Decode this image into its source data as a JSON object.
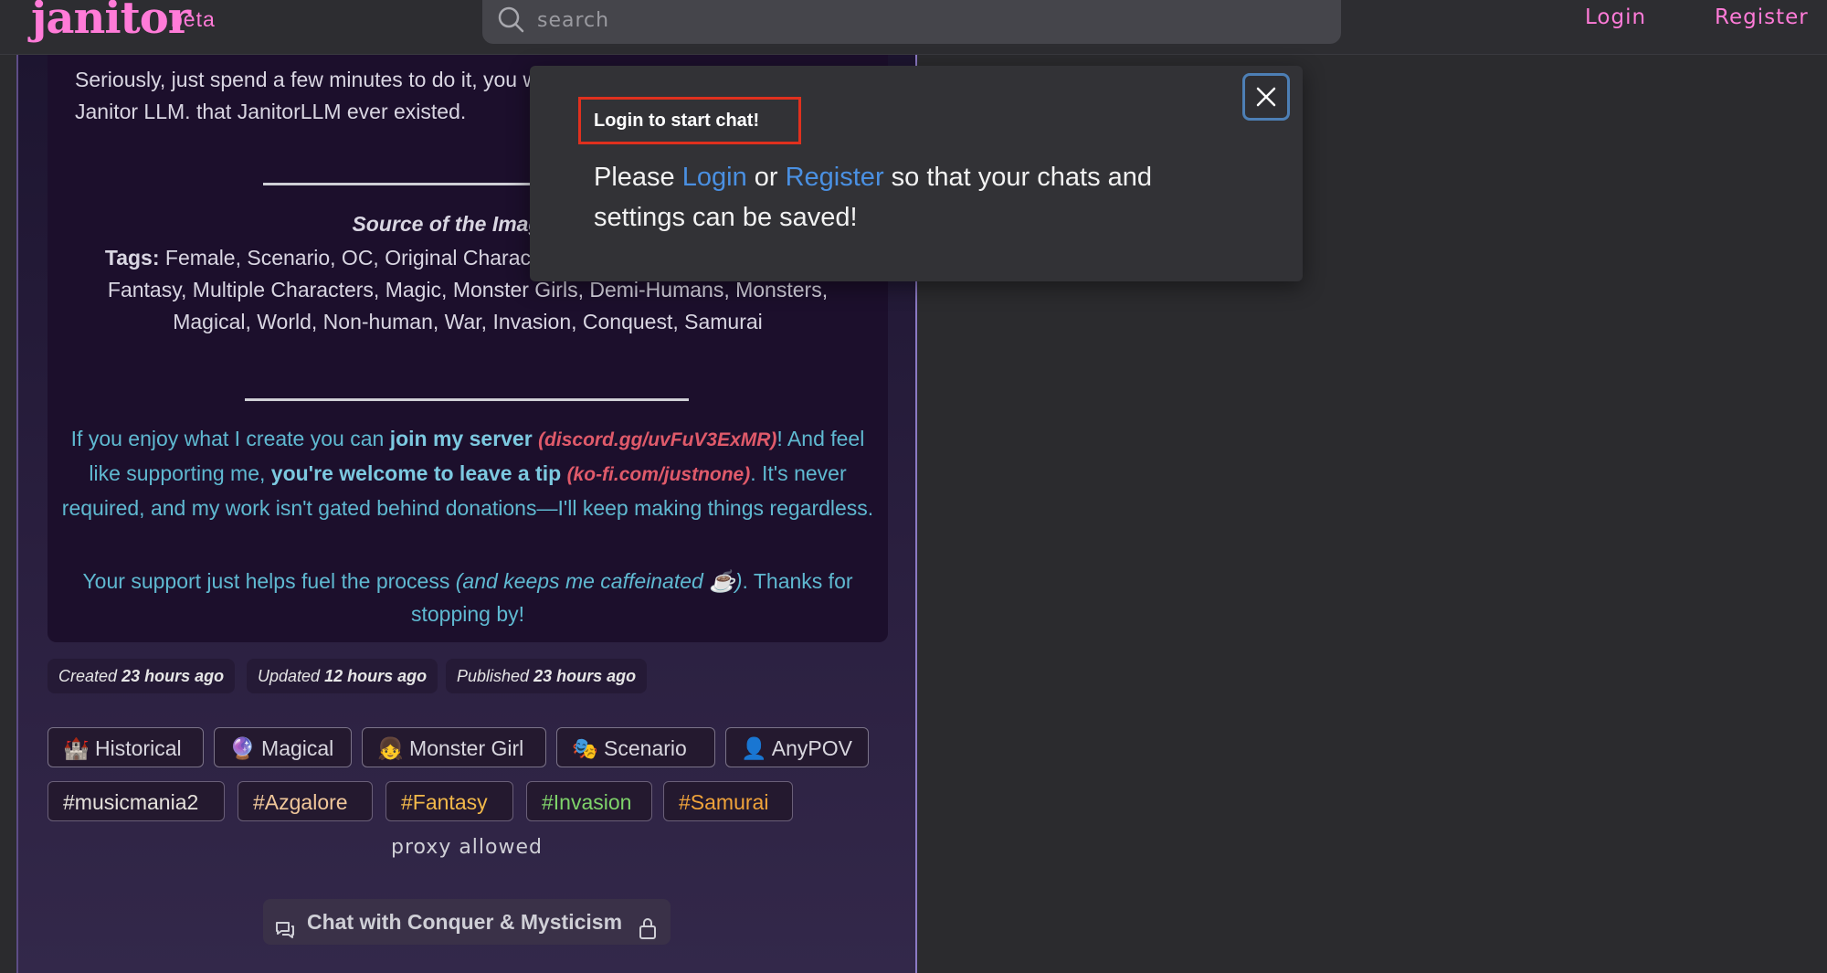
{
  "header": {
    "logo": "janitor",
    "beta": "beta",
    "search_placeholder": "search",
    "login": "Login",
    "register": "Register"
  },
  "description": {
    "para1": "Seriously, just spend a few minutes to do it, you w generational leap in quality from the Janitor LLM. that JanitorLLM ever existed.",
    "source_label": "Source of the Image: M",
    "tags_label": "Tags:",
    "tags_text": " Female, Scenario, OC, Original Character, Medieval, Fantasy, Medieval Fantasy, Multiple Characters, Magic, Monster Girls, Demi-Humans, Monsters, Magical, World, Non-human, War, Invasion, Conquest, Samurai",
    "support": {
      "t1": "If you enjoy what I create you can ",
      "join": "join my server",
      "discord": "(discord.gg/uvFuV3ExMR)",
      "t2": "! And feel like supporting me, ",
      "tip": "you're welcome to leave a tip",
      "kofi": "(ko-fi.com/justnone)",
      "t3": ". It's never required, and my work isn't gated behind donations—I'll keep making things regardless.",
      "t4": "Your support just helps fuel the process ",
      "caff": "(and keeps me caffeinated ☕)",
      "t5": ". Thanks for stopping by!"
    }
  },
  "meta": {
    "created_label": "Created",
    "created": "23 hours ago",
    "updated_label": "Updated",
    "updated": "12 hours ago",
    "published_label": "Published",
    "published": "23 hours ago"
  },
  "categories": [
    {
      "emoji": "🏰",
      "label": "Historical"
    },
    {
      "emoji": "🔮",
      "label": "Magical"
    },
    {
      "emoji": "👧",
      "label": "Monster Girl"
    },
    {
      "emoji": "🎭",
      "label": "Scenario"
    },
    {
      "emoji": "👤",
      "label": "AnyPOV"
    }
  ],
  "hashtags": [
    {
      "label": "#musicmania2",
      "color": "#e6e2dc"
    },
    {
      "label": "#Azgalore",
      "color": "#f0c79a"
    },
    {
      "label": "#Fantasy",
      "color": "#f2b94a"
    },
    {
      "label": "#Invasion",
      "color": "#7fd36a"
    },
    {
      "label": "#Samurai",
      "color": "#f0a33a"
    }
  ],
  "proxy": "proxy allowed",
  "chat_button": "Chat with Conquer & Mysticism",
  "modal": {
    "title": "Login to start chat!",
    "please": "Please ",
    "login": "Login",
    "or": " or ",
    "register": "Register",
    "rest": " so that your chats and settings can be saved!"
  }
}
